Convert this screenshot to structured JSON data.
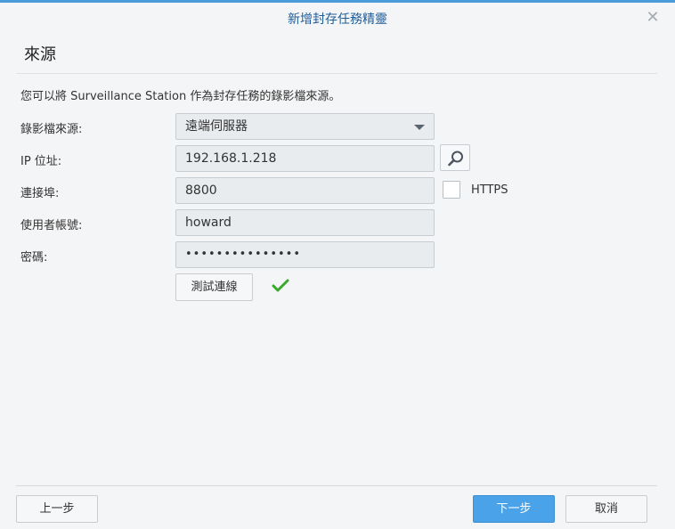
{
  "dialog": {
    "title": "新增封存任務精靈",
    "close_icon": "close-icon"
  },
  "section": {
    "title": "來源"
  },
  "intro": "您可以將 Surveillance Station 作為封存任務的錄影檔來源。",
  "form": {
    "source": {
      "label": "錄影檔來源:",
      "value": "遠端伺服器"
    },
    "ip": {
      "label": "IP 位址:",
      "value": "192.168.1.218",
      "search_icon": "search-icon"
    },
    "port": {
      "label": "連接埠:",
      "value": "8800",
      "https_label": "HTTPS",
      "https_checked": false
    },
    "username": {
      "label": "使用者帳號:",
      "value": "howard"
    },
    "password": {
      "label": "密碼:",
      "value": "•••••••••••••••"
    },
    "test_button": "測試連線",
    "test_status_icon": "checkmark-icon",
    "test_status_color": "#3aa82c"
  },
  "footer": {
    "prev": "上一步",
    "next": "下一步",
    "cancel": "取消"
  },
  "colors": {
    "accent": "#4a9bd9",
    "title_text": "#1f5d99",
    "primary_button": "#4aa3e8"
  }
}
